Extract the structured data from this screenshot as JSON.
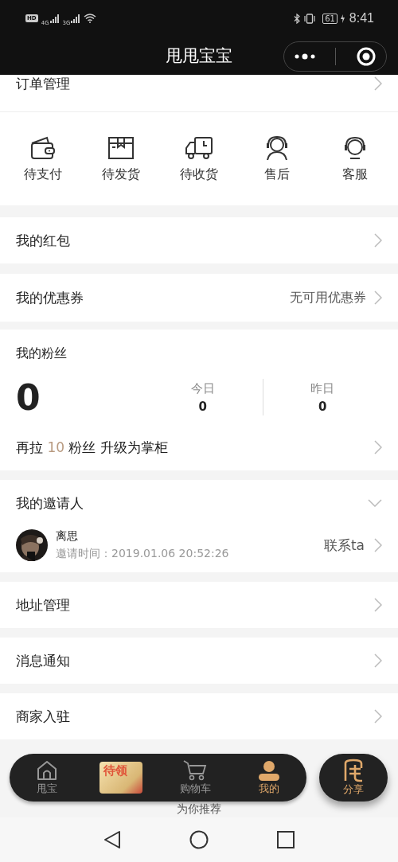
{
  "status_bar": {
    "hd": "HD",
    "net1": "4G",
    "net2": "3G",
    "battery": "61",
    "time": "8:41"
  },
  "title_bar": {
    "title": "甩甩宝宝"
  },
  "order_section": {
    "title": "订单管理",
    "items": [
      {
        "label": "待支付",
        "kind": "wallet"
      },
      {
        "label": "待发货",
        "kind": "box"
      },
      {
        "label": "待收货",
        "kind": "truck"
      },
      {
        "label": "售后",
        "kind": "person"
      },
      {
        "label": "客服",
        "kind": "headset"
      }
    ]
  },
  "red_packets": {
    "label": "我的红包"
  },
  "coupons": {
    "label": "我的优惠券",
    "value": "无可用优惠券"
  },
  "fans": {
    "title": "我的粉丝",
    "total": "0",
    "stats": [
      {
        "label": "今日",
        "value": "0"
      },
      {
        "label": "昨日",
        "value": "0"
      }
    ],
    "upgrade": {
      "before": "再拉",
      "count": "10",
      "after": "粉丝 升级为掌柜"
    }
  },
  "inviter": {
    "title": "我的邀请人",
    "expanded": true,
    "name": "离思",
    "time": "邀请时间：2019.01.06 20:52:26",
    "action": "联系ta"
  },
  "menu": [
    {
      "label": "地址管理"
    },
    {
      "label": "消息通知"
    },
    {
      "label": "商家入驻"
    }
  ],
  "recommend": {
    "label": "为你推荐"
  },
  "tab_bar": {
    "items": [
      {
        "kind": "home",
        "label": "甩宝",
        "selected": false
      },
      {
        "kind": "promo",
        "label": "待领",
        "selected": false
      },
      {
        "kind": "cart",
        "label": "购物车",
        "selected": false
      },
      {
        "kind": "user",
        "label": "我的",
        "selected": true
      }
    ],
    "share": {
      "label": "分享"
    }
  }
}
